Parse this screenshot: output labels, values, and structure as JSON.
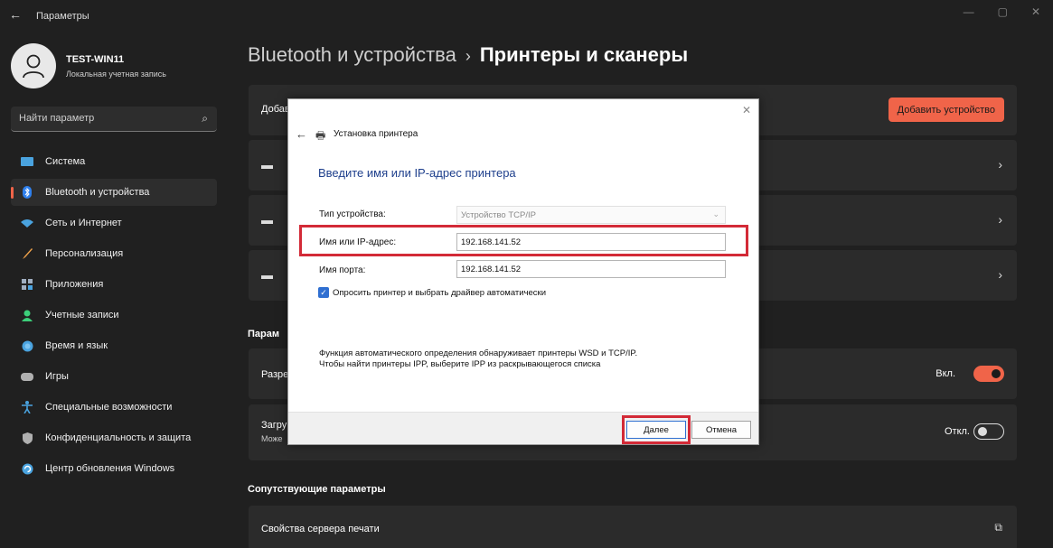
{
  "window": {
    "app_title": "Параметры",
    "controls": [
      "—",
      "▢",
      "✕"
    ]
  },
  "profile": {
    "name": "TEST-WIN11",
    "account_type": "Локальная учетная запись"
  },
  "search": {
    "placeholder": "Найти параметр"
  },
  "sidebar": {
    "items": [
      {
        "label": "Система",
        "icon": "system-icon",
        "color": "#4aa3df"
      },
      {
        "label": "Bluetooth и устройства",
        "icon": "bluetooth-icon",
        "color": "#2f80ed",
        "active": true
      },
      {
        "label": "Сеть и Интернет",
        "icon": "wifi-icon",
        "color": "#4aa3df"
      },
      {
        "label": "Персонализация",
        "icon": "brush-icon",
        "color": "#f0a24a"
      },
      {
        "label": "Приложения",
        "icon": "apps-icon",
        "color": "#a0aec0"
      },
      {
        "label": "Учетные записи",
        "icon": "account-icon",
        "color": "#3ccf7a"
      },
      {
        "label": "Время и язык",
        "icon": "globe-icon",
        "color": "#4aa3df"
      },
      {
        "label": "Игры",
        "icon": "gamepad-icon",
        "color": "#b0b0b0"
      },
      {
        "label": "Специальные возможности",
        "icon": "accessibility-icon",
        "color": "#4aa3df"
      },
      {
        "label": "Конфиденциальность и защита",
        "icon": "shield-icon",
        "color": "#b0b0b0"
      },
      {
        "label": "Центр обновления Windows",
        "icon": "update-icon",
        "color": "#4aa3df"
      }
    ]
  },
  "breadcrumb": {
    "parent": "Bluetooth и устройства",
    "separator": "›",
    "current": "Принтеры и сканеры"
  },
  "main": {
    "add_row_label": "Добав",
    "add_button": "Добавить устройство",
    "section_params_title": "Парам",
    "row_allow_label": "Разре",
    "row_allow_value": "Вкл.",
    "row_download_label": "Загру",
    "row_download_sub": "Може",
    "row_download_value": "Откл.",
    "related_title": "Сопутствующие параметры",
    "print_server_label": "Свойства сервера печати"
  },
  "dialog": {
    "title": "Установка принтера",
    "heading": "Введите имя или IP-адрес принтера",
    "device_type_label": "Тип устройства:",
    "device_type_value": "Устройство TCP/IP",
    "host_label": "Имя или IP-адрес:",
    "host_value": "192.168.141.52",
    "port_label": "Имя порта:",
    "port_value": "192.168.141.52",
    "auto_driver_label": "Опросить принтер и выбрать драйвер автоматически",
    "auto_driver_checked": true,
    "info_line1": "Функция автоматического определения обнаруживает принтеры WSD и TCP/IP.",
    "info_line2": "Чтобы найти принтеры IPP, выберите IPP из раскрывающегося списка",
    "next_button": "Далее",
    "cancel_button": "Отмена"
  },
  "colors": {
    "accent": "#f06449",
    "highlight": "#d32a37",
    "background": "#202020",
    "card": "#2b2b2b"
  }
}
